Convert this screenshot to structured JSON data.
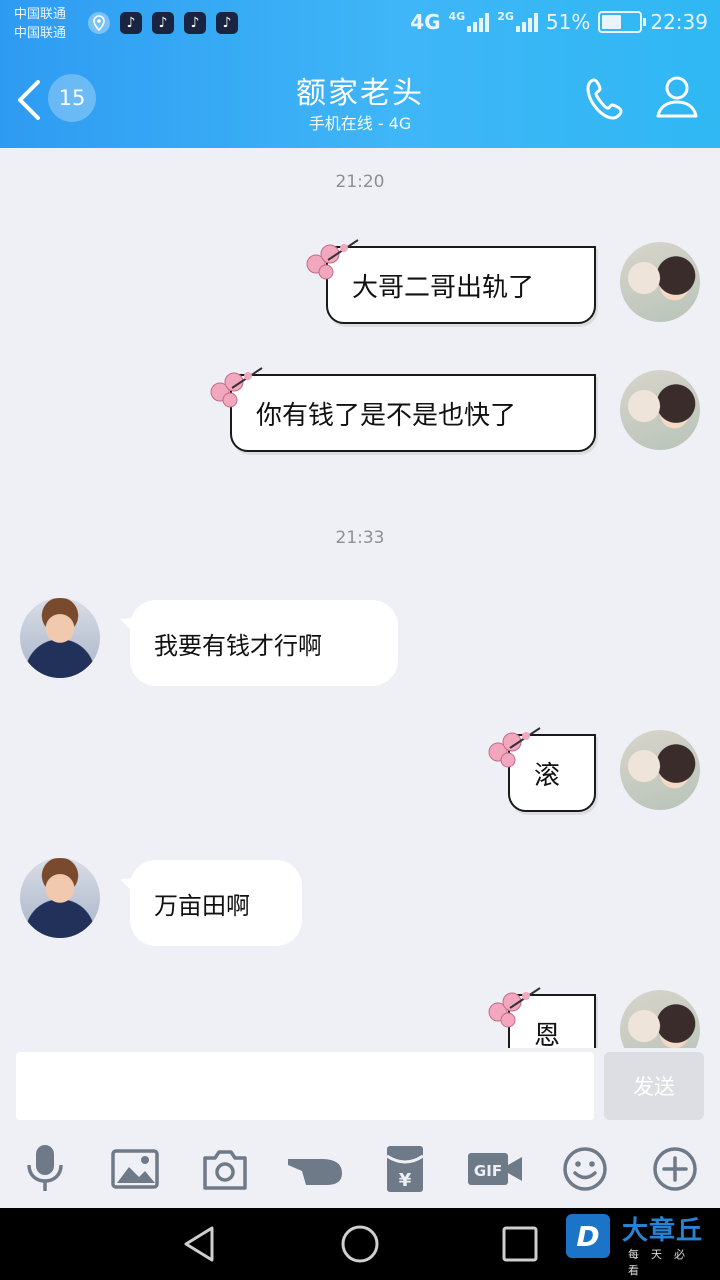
{
  "status_bar": {
    "carrier_1": "中国联通",
    "carrier_2": "中国联通",
    "notification_icons": [
      "location-icon",
      "tiktok-icon",
      "tiktok-icon",
      "tiktok-icon",
      "tiktok-icon"
    ],
    "network_1": "4G",
    "network_2_small": "4G",
    "network_3_small": "2G",
    "battery_percent": "51%",
    "battery_level": 0.51,
    "time": "22:39"
  },
  "header": {
    "unread_count": "15",
    "contact_name": "额家老头",
    "contact_status": "手机在线 - 4G",
    "accent_color": "#2e9bf2"
  },
  "chat": {
    "timestamps": [
      "21:20",
      "21:33"
    ],
    "messages": [
      {
        "direction": "out",
        "text": "大哥二哥出轨了"
      },
      {
        "direction": "out",
        "text": "你有钱了是不是也快了"
      },
      {
        "direction": "in",
        "text": "我要有钱才行啊"
      },
      {
        "direction": "out",
        "text": "滚"
      },
      {
        "direction": "in",
        "text": "万亩田啊"
      },
      {
        "direction": "out",
        "text": "恩"
      }
    ]
  },
  "input": {
    "value": "",
    "send_label": "发送"
  },
  "toolbar": {
    "items": [
      "microphone-icon",
      "image-icon",
      "camera-icon",
      "poke-icon",
      "red-packet-icon",
      "gif-icon",
      "emoji-icon",
      "plus-icon"
    ],
    "gif_label": "GIF",
    "red_packet_symbol": "¥"
  },
  "watermark": {
    "logo_letter": "D",
    "brand": "大章丘",
    "slogan": "每天必看"
  }
}
